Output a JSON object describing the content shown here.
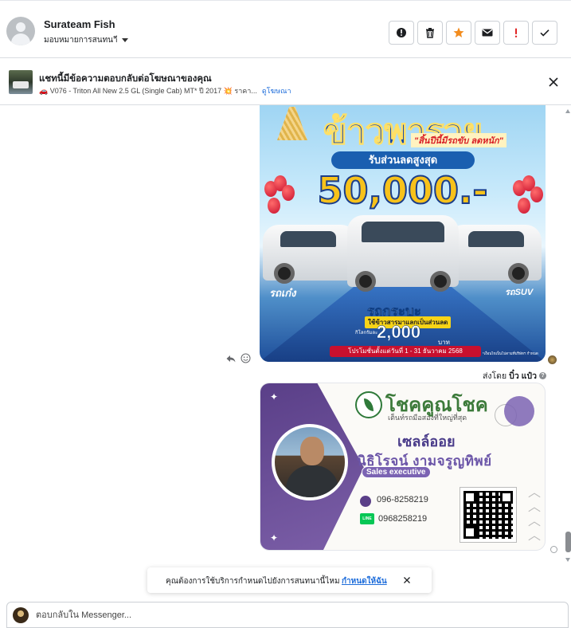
{
  "header": {
    "contact_name": "Surateam Fish",
    "assign_label": "มอบหมายการสนทนาี",
    "actions": [
      {
        "icon": "alert-circle-icon",
        "color": "#1c1e21"
      },
      {
        "icon": "trash-icon",
        "color": "#1c1e21"
      },
      {
        "icon": "star-icon",
        "color": "#f28c1e"
      },
      {
        "icon": "mail-icon",
        "color": "#1c1e21"
      },
      {
        "icon": "exclamation-icon",
        "color": "#e02424"
      },
      {
        "icon": "check-icon",
        "color": "#1c1e21"
      }
    ]
  },
  "ad_bar": {
    "title": "แชทนี้มีข้อความตอบกลับต่อโฆษณาของคุณ",
    "subtitle": "🚗 V076 - Triton All New 2.5 GL (Single Cab) MT* ปี 2017 💥 ราคา...",
    "view_ad_link": "ดูโฆษณา"
  },
  "promo_image": {
    "headline": "ข้าวพารวย",
    "headline_sub": "\"สิ้นปีนี้มีรถขับ ลดหนัก\"",
    "discount_label": "รับส่วนลดสูงสุด",
    "discount_amount": "50,000.-",
    "category_left": "รถเก๋ง",
    "category_middle": "รถกระบะ",
    "category_right": "รถSUV",
    "trade_label": "ใช้ข้าวสารมาแลกเป็นส่วนลด",
    "per_kg": "กิโลกรัมละ",
    "price_per_kg": "2,000",
    "baht": "บาท",
    "period": "โปรโมชั่นตั้งแต่วันที่ 1 - 31 ธันวาคม 2568",
    "fine_print": "*เงื่อนไขเป็นไปตามที่บริษัทฯ กำหนด"
  },
  "sent_by": {
    "prefix": "ส่งโดย",
    "name": "บิ๋ว แป๋ว"
  },
  "business_card": {
    "brand": "โชคคูณโชค",
    "tagline": "เต็นท์รถมือสองที่ใหญ่ที่สุด",
    "role": "เซลล์ออย",
    "person_name": "นิธิโรจน์  งามจรูญทิพย์",
    "job_title": "Sales executive",
    "phone": "096-8258219",
    "line_label": "LINE",
    "line_id": "0968258219"
  },
  "toast": {
    "text": "คุณต้องการใช้บริการกำหนดไปยังการสนทนานี้ไหม",
    "link": "กำหนดให้ฉัน"
  },
  "composer": {
    "placeholder": "ตอบกลับใน Messenger..."
  }
}
